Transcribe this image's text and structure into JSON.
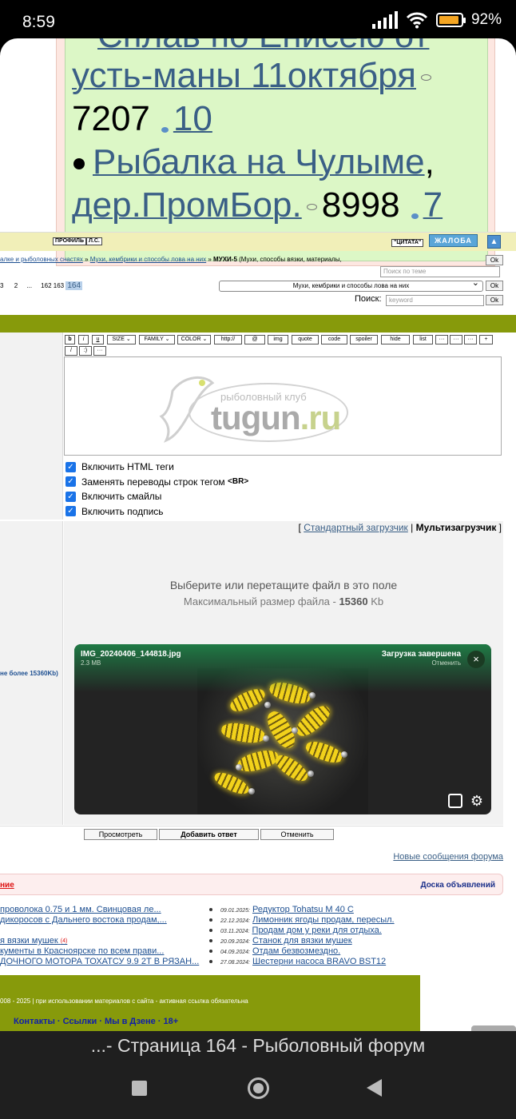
{
  "status": {
    "time": "8:59",
    "battery": "92%",
    "battery_level": 0.92
  },
  "topic": {
    "line1": "Сплав по Енисею от",
    "line2_link": "усть-маны 11октября",
    "line3_count": "7207",
    "line3_reply": "10",
    "line4_link": "Рыбалка на Чулыме",
    "line4_comma": ",",
    "line5_link": "дер.ПромБор.",
    "line5_count": "8998",
    "line5_reply": "7"
  },
  "bar": {
    "profile": "ПРОФИЛЬ",
    "pm": "Л.С.",
    "quote": "\"ЦИТАТА\"",
    "complaint": "ЖАЛОБА",
    "up": "▲"
  },
  "breadcrumb": {
    "part1": "алке и рыболовных снастях",
    "sep1": " » ",
    "part2": "Мухи, кембрики и способы лова на них",
    "sep2": " » ",
    "current": "МУХИ-5",
    "rest": " (Мухи, способы вязки, материалы,"
  },
  "ok": "Ok",
  "topic_search_placeholder": "Поиск по теме",
  "pager": {
    "p3": "3",
    "p2": "2",
    "ellipsis": "...",
    "p162": "162",
    "p163": "163",
    "current": "164"
  },
  "forum_select": "Мухи, кембрики и способы лова на них",
  "search": {
    "label": "Поиск:",
    "placeholder": "keyword"
  },
  "toolbar": {
    "b": "b",
    "i": "i",
    "u": "u",
    "size": "SIZE",
    "family": "FAMILY",
    "color": "COLOR",
    "http": "http://",
    "at": "@",
    "img": "img",
    "quote": "quote",
    "code": "code",
    "spoiler": "spoiler",
    "hide": "hide",
    "list": "list",
    "e1": "···",
    "e2": "···",
    "e3": "···",
    "plus": "+",
    "slash": "/",
    "paren": ":)",
    "e4": "···"
  },
  "logo": {
    "club": "рыболовный клуб",
    "name_main": "tugun",
    "name_tld": ".ru"
  },
  "options": {
    "html": "Включить HTML теги",
    "br_prefix": "Заменять переводы строк тегом ",
    "br_tag": "<BR>",
    "smiles": "Включить смайлы",
    "sign": "Включить подпись"
  },
  "uploader": {
    "bracket_open": "[ ",
    "standard": "Стандартный загрузчик",
    "pipe": " | ",
    "multi": "Мультизагрузчик",
    "bracket_close": " ]",
    "drop_title": "Выберите или перетащите файл в это поле",
    "max_prefix": "Максимальный размер файла - ",
    "max_value": "15360",
    "max_unit": " Kb",
    "left_note": "не более 15360Kb)",
    "file_name": "IMG_20240406_144818.jpg",
    "file_size": "2.3 MB",
    "status": "Загрузка завершена",
    "cancel": "Отменить",
    "close": "×"
  },
  "buttons": {
    "preview": "Просмотреть",
    "submit": "Добавить ответ",
    "cancel": "Отменить"
  },
  "new_messages": "Новые сообщения форума",
  "section_bar": {
    "left": "ние",
    "right": "Доска объявлений"
  },
  "left_list": [
    {
      "text": "проволока 0.75 и 1 мм. Свинцовая ле..."
    },
    {
      "text": "дикоросов с Дальнего востока продам,..."
    },
    {
      "text": ""
    },
    {
      "text": "я вязки мушек",
      "num": "(4)"
    },
    {
      "text": "кументы в Красноярске по всем прави..."
    },
    {
      "text": "ДОЧНОГО МОТОРА ТОХАТСУ 9.9 2Т В РЯЗАН..."
    }
  ],
  "right_list": [
    {
      "date": "09.01.2025:",
      "text": "Редуктор Tohatsu M 40 C"
    },
    {
      "date": "22.12.2024:",
      "text": "Лимонник ягоды продам, пересыл."
    },
    {
      "date": "03.11.2024:",
      "text": "Продам дом у реки для отдыха."
    },
    {
      "date": "20.09.2024:",
      "text": "Станок для вязки мушек"
    },
    {
      "date": "04.09.2024:",
      "text": "Отдам безвозмездно."
    },
    {
      "date": "27.08.2024:",
      "text": "Шестерни насоса BRAVO BST12"
    }
  ],
  "footer": {
    "copyright": "008 - 2025 | при использовании материалов с сайта - активная ссылка обязательна",
    "links": "Контакты · Ссылки · Мы в Дзене · 18+"
  },
  "browser_title": "...- Страница 164 - Рыболовный форум",
  "colors": {
    "olive": "#879a0b",
    "link": "#3a5f86",
    "topic_bg": "#dcf7c6",
    "accent_blue": "#1a73e8"
  }
}
